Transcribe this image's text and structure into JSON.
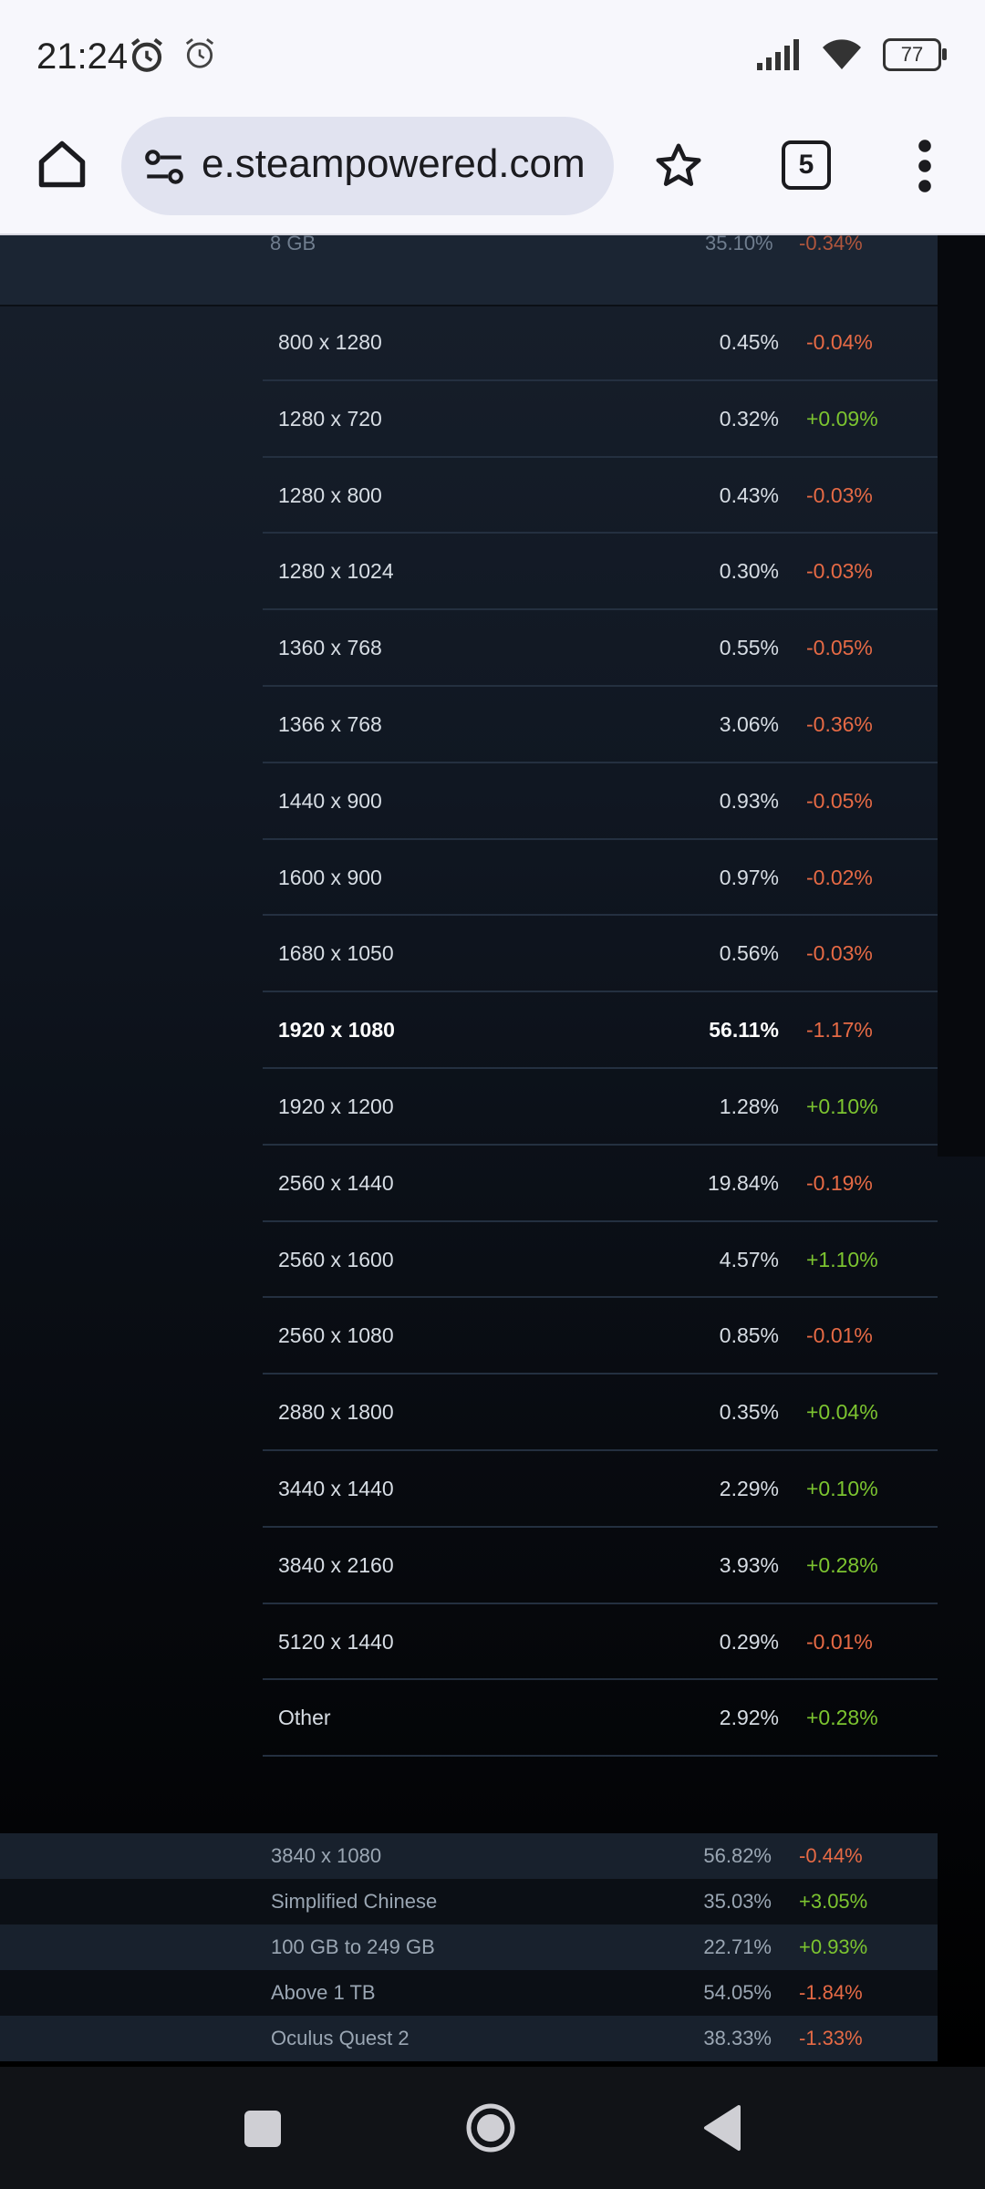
{
  "status_bar": {
    "time": "21:24",
    "battery": "77",
    "icons": [
      "alarm-clock-icon",
      "alarm-icon",
      "signal-icon",
      "wifi-icon",
      "battery-icon"
    ]
  },
  "browser": {
    "url": "e.steampowered.com",
    "tab_count": "5",
    "icons": [
      "home-icon",
      "site-settings-icon",
      "star-icon",
      "tabs-icon",
      "more-icon"
    ]
  },
  "top_row": {
    "label": "8 GB",
    "pct": "35.10%",
    "change": "-0.34%"
  },
  "resolutions": [
    {
      "name": "800 x 1280",
      "pct": "0.45%",
      "change": "-0.04%",
      "trend": "neg",
      "bold": false
    },
    {
      "name": "1280 x 720",
      "pct": "0.32%",
      "change": "+0.09%",
      "trend": "pos",
      "bold": false
    },
    {
      "name": "1280 x 800",
      "pct": "0.43%",
      "change": "-0.03%",
      "trend": "neg",
      "bold": false
    },
    {
      "name": "1280 x 1024",
      "pct": "0.30%",
      "change": "-0.03%",
      "trend": "neg",
      "bold": false
    },
    {
      "name": "1360 x 768",
      "pct": "0.55%",
      "change": "-0.05%",
      "trend": "neg",
      "bold": false
    },
    {
      "name": "1366 x 768",
      "pct": "3.06%",
      "change": "-0.36%",
      "trend": "neg",
      "bold": false
    },
    {
      "name": "1440 x 900",
      "pct": "0.93%",
      "change": "-0.05%",
      "trend": "neg",
      "bold": false
    },
    {
      "name": "1600 x 900",
      "pct": "0.97%",
      "change": "-0.02%",
      "trend": "neg",
      "bold": false
    },
    {
      "name": "1680 x 1050",
      "pct": "0.56%",
      "change": "-0.03%",
      "trend": "neg",
      "bold": false
    },
    {
      "name": "1920 x 1080",
      "pct": "56.11%",
      "change": "-1.17%",
      "trend": "neg",
      "bold": true
    },
    {
      "name": "1920 x 1200",
      "pct": "1.28%",
      "change": "+0.10%",
      "trend": "pos",
      "bold": false
    },
    {
      "name": "2560 x 1440",
      "pct": "19.84%",
      "change": "-0.19%",
      "trend": "neg",
      "bold": false
    },
    {
      "name": "2560 x 1600",
      "pct": "4.57%",
      "change": "+1.10%",
      "trend": "pos",
      "bold": false
    },
    {
      "name": "2560 x 1080",
      "pct": "0.85%",
      "change": "-0.01%",
      "trend": "neg",
      "bold": false
    },
    {
      "name": "2880 x 1800",
      "pct": "0.35%",
      "change": "+0.04%",
      "trend": "pos",
      "bold": false
    },
    {
      "name": "3440 x 1440",
      "pct": "2.29%",
      "change": "+0.10%",
      "trend": "pos",
      "bold": false
    },
    {
      "name": "3840 x 2160",
      "pct": "3.93%",
      "change": "+0.28%",
      "trend": "pos",
      "bold": false
    },
    {
      "name": "5120 x 1440",
      "pct": "0.29%",
      "change": "-0.01%",
      "trend": "neg",
      "bold": false
    },
    {
      "name": "Other",
      "pct": "2.92%",
      "change": "+0.28%",
      "trend": "pos",
      "bold": false
    }
  ],
  "summary": [
    {
      "name": "3840 x 1080",
      "pct": "56.82%",
      "change": "-0.44%",
      "trend": "neg"
    },
    {
      "name": "Simplified Chinese",
      "pct": "35.03%",
      "change": "+3.05%",
      "trend": "pos"
    },
    {
      "name": "100 GB to 249 GB",
      "pct": "22.71%",
      "change": "+0.93%",
      "trend": "pos"
    },
    {
      "name": "Above 1 TB",
      "pct": "54.05%",
      "change": "-1.84%",
      "trend": "neg"
    },
    {
      "name": "Oculus Quest 2",
      "pct": "38.33%",
      "change": "-1.33%",
      "trend": "neg"
    }
  ],
  "nav": {
    "icons": [
      "recents-square-icon",
      "home-circle-icon",
      "back-triangle-icon"
    ]
  },
  "colors": {
    "negative": "#e66a45",
    "positive": "#7cc430",
    "bg": "#101722"
  }
}
